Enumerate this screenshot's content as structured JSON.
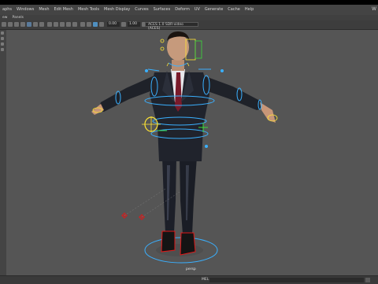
{
  "menubar": {
    "items": [
      "aphs",
      "Windows",
      "Mesh",
      "Edit Mesh",
      "Mesh Tools",
      "Mesh Display",
      "Curves",
      "Surfaces",
      "Deform",
      "UV",
      "Generate",
      "Cache",
      "Help"
    ],
    "right_label": "W"
  },
  "panel_menu": {
    "items": [
      "ew",
      "Panels"
    ]
  },
  "toolbar": {
    "field_a": "0.00",
    "field_b": "1.00",
    "colorspace": "ACES 1.0 SDR-video (ACES)"
  },
  "viewport": {
    "camera_label": "persp",
    "background_color": "#555555"
  },
  "bottom": {
    "mel_label": "MEL"
  },
  "colors": {
    "rig_blue": "#3ab0ff",
    "rig_yellow": "#ffe533",
    "rig_red": "#e01818",
    "rig_green": "#3bdc3b"
  }
}
